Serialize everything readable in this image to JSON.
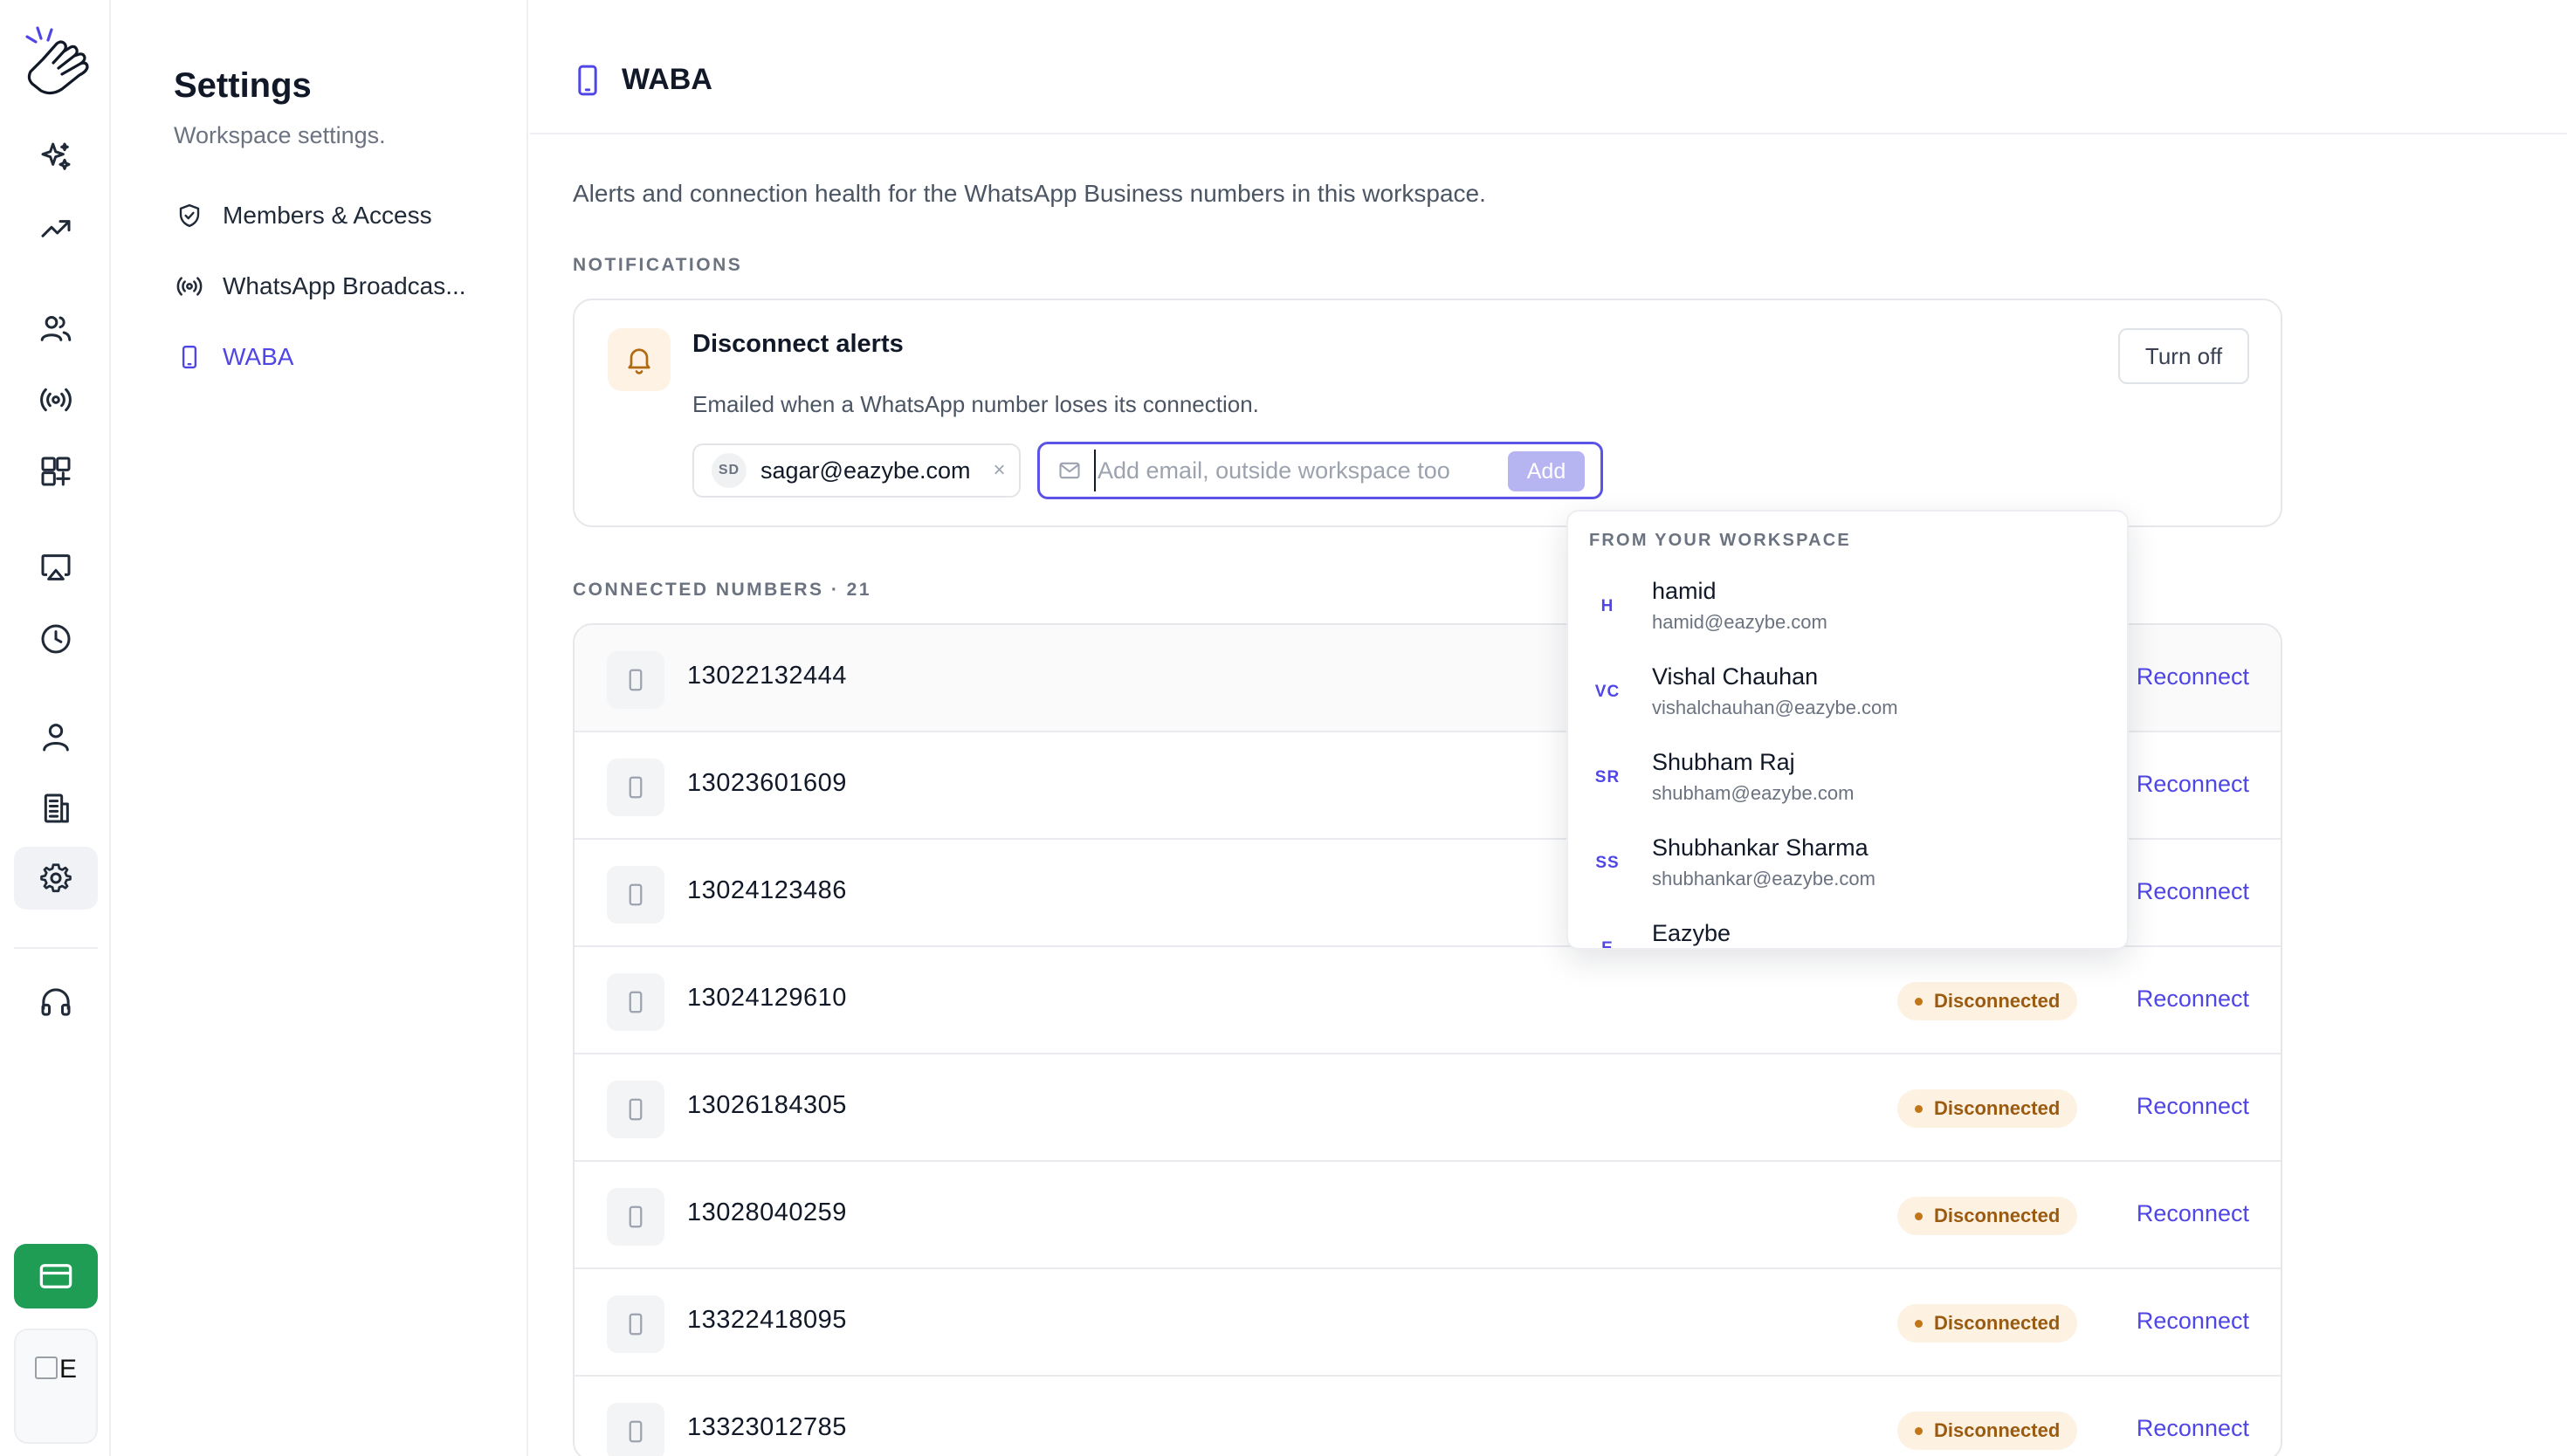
{
  "settings": {
    "title": "Settings",
    "subtitle": "Workspace settings.",
    "nav": [
      {
        "label": "Members & Access",
        "icon": "shield-check-icon"
      },
      {
        "label": "WhatsApp Broadcas...",
        "icon": "broadcast-icon"
      },
      {
        "label": "WABA",
        "icon": "phone-icon",
        "active": true
      }
    ]
  },
  "rail": {
    "icons": [
      "logo-hand-icon",
      "sparkle-icon",
      "trend-up-icon",
      "users-icon",
      "broadcast-icon",
      "grid-plus-icon",
      "cast-icon",
      "clock-icon",
      "user-icon",
      "building-icon",
      "gear-icon",
      "headset-icon",
      "credit-card-icon"
    ],
    "avatar_alt": "E"
  },
  "page": {
    "title": "WABA",
    "intro": "Alerts and connection health for the WhatsApp Business numbers in this workspace."
  },
  "notifications": {
    "section_label": "NOTIFICATIONS",
    "title": "Disconnect alerts",
    "description": "Emailed when a WhatsApp number loses its connection.",
    "turn_off_label": "Turn off",
    "recipient": {
      "initials": "SD",
      "email": "sagar@eazybe.com",
      "remove": "×"
    },
    "input_placeholder": "Add email, outside workspace too",
    "add_label": "Add"
  },
  "dropdown": {
    "header": "FROM YOUR WORKSPACE",
    "items": [
      {
        "initials": "H",
        "name": "hamid",
        "email": "hamid@eazybe.com"
      },
      {
        "initials": "VC",
        "name": "Vishal Chauhan",
        "email": "vishalchauhan@eazybe.com"
      },
      {
        "initials": "SR",
        "name": "Shubham Raj",
        "email": "shubham@eazybe.com"
      },
      {
        "initials": "SS",
        "name": "Shubhankar Sharma",
        "email": "shubhankar@eazybe.com"
      },
      {
        "initials": "E",
        "name": "Eazybe",
        "email": ""
      }
    ]
  },
  "connected": {
    "section_label": "CONNECTED NUMBERS · 21",
    "status_label": "Disconnected",
    "action_label": "Reconnect",
    "numbers": [
      "13022132444",
      "13023601609",
      "13024123486",
      "13024129610",
      "13026184305",
      "13028040259",
      "13322418095",
      "13323012785"
    ]
  },
  "colors": {
    "accent": "#4f46e5",
    "status_bg": "#fdf1e2",
    "status_text": "#9a5b10",
    "billing_green": "#1f9d55"
  }
}
